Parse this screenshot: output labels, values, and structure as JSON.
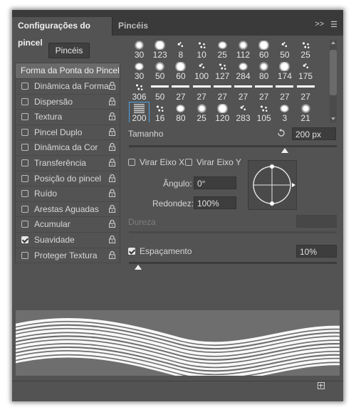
{
  "tabs": [
    {
      "label": "Configurações do pincel"
    },
    {
      "label": "Pincéis"
    }
  ],
  "brushes_button": "Pincéis",
  "sidebar": {
    "header": "Forma da Ponta do Pincel",
    "items": [
      {
        "label": "Dinâmica da Forma",
        "checked": false
      },
      {
        "label": "Dispersão",
        "checked": false
      },
      {
        "label": "Textura",
        "checked": false
      },
      {
        "label": "Pincel Duplo",
        "checked": false
      },
      {
        "label": "Dinâmica da Cor",
        "checked": false
      },
      {
        "label": "Transferência",
        "checked": false
      },
      {
        "label": "Posição do pincel",
        "checked": false
      },
      {
        "label": "Ruído",
        "checked": false
      },
      {
        "label": "Arestas Aguadas",
        "checked": false
      },
      {
        "label": "Acumular",
        "checked": false
      },
      {
        "label": "Suavidade",
        "checked": true
      },
      {
        "label": "Proteger Textura",
        "checked": false
      }
    ]
  },
  "brush_grid": {
    "rows": [
      [
        "30",
        "123",
        "8",
        "10",
        "25",
        "112",
        "60",
        "50",
        "25"
      ],
      [
        "30",
        "50",
        "60",
        "100",
        "127",
        "284",
        "80",
        "174",
        "175"
      ],
      [
        "306",
        "50",
        "27",
        "27",
        "27",
        "27",
        "27",
        "27",
        "27"
      ],
      [
        "200",
        "16",
        "80",
        "25",
        "120",
        "283",
        "105",
        "3",
        "21"
      ]
    ],
    "selected": "200"
  },
  "size": {
    "label": "Tamanho",
    "value": "200 px"
  },
  "flip_x": {
    "label": "Virar Eixo X",
    "checked": false
  },
  "flip_y": {
    "label": "Virar Eixo Y",
    "checked": false
  },
  "angle": {
    "label": "Ângulo:",
    "value": "0°"
  },
  "roundness": {
    "label": "Redondez:",
    "value": "100%"
  },
  "hardness": {
    "label": "Dureza"
  },
  "spacing": {
    "label": "Espaçamento",
    "value": "10%",
    "checked": true
  }
}
